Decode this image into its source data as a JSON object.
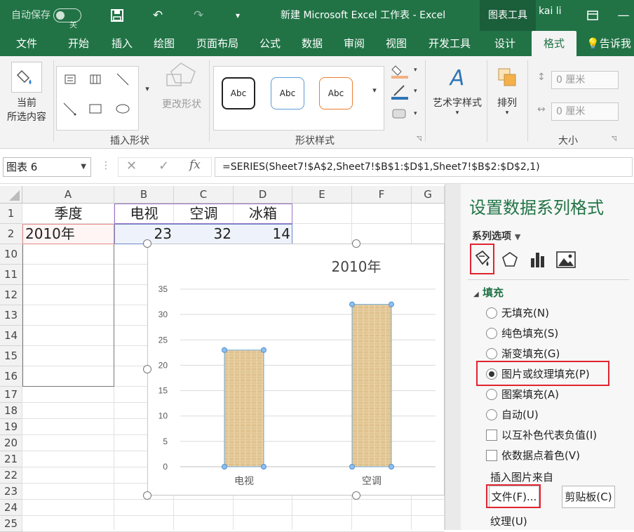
{
  "titlebar": {
    "autosave_label": "自动保存",
    "autosave_state": "关",
    "title": "新建 Microsoft Excel 工作表  -  Excel",
    "context_tab": "图表工具",
    "user": "kai li"
  },
  "tabs": [
    "文件",
    "开始",
    "插入",
    "绘图",
    "页面布局",
    "公式",
    "数据",
    "审阅",
    "视图",
    "开发工具",
    "设计",
    "格式"
  ],
  "active_tab": "格式",
  "tell_me": "告诉我",
  "ribbon": {
    "current_selection_line1": "当前",
    "current_selection_line2": "所选内容",
    "change_shape": "更改形状",
    "group_insert_shapes": "插入形状",
    "style_sample": "Abc",
    "group_shape_styles": "形状样式",
    "wordart": "艺术字样式",
    "arrange": "排列",
    "height_value": "0 厘米",
    "width_value": "0 厘米",
    "group_size": "大小"
  },
  "formula_bar": {
    "name_box": "图表 6",
    "fx": "fx",
    "formula": "=SERIES(Sheet7!$A$2,Sheet7!$B$1:$D$1,Sheet7!$B$2:$D$2,1)"
  },
  "sheet": {
    "columns": [
      "A",
      "B",
      "C",
      "D",
      "E",
      "F",
      "G"
    ],
    "rows": [
      "1",
      "2",
      "10",
      "11",
      "12",
      "13",
      "14",
      "15",
      "16",
      "17",
      "18",
      "19",
      "20",
      "21",
      "22",
      "23",
      "24",
      "25"
    ],
    "a1": "季度",
    "b1": "电视",
    "c1": "空调",
    "d1": "冰箱",
    "a2": "2010年",
    "b2": "23",
    "c2": "32",
    "d2": "14"
  },
  "chart_data": {
    "type": "bar",
    "title": "2010年",
    "categories": [
      "电视",
      "空调"
    ],
    "values": [
      23,
      32
    ],
    "ylim": [
      0,
      35
    ],
    "yticks": [
      "0",
      "5",
      "10",
      "15",
      "20",
      "25",
      "30",
      "35"
    ],
    "grid": true,
    "fill": "texture"
  },
  "panel": {
    "title": "设置数据系列格式",
    "series_options": "系列选项",
    "fill_section": "填充",
    "fill_options": [
      "无填充(N)",
      "纯色填充(S)",
      "渐变填充(G)",
      "图片或纹理填充(P)",
      "图案填充(A)",
      "自动(U)"
    ],
    "selected_fill": "图片或纹理填充(P)",
    "invert_negative": "以互补色代表负值(I)",
    "vary_colors": "依数据点着色(V)",
    "insert_from": "插入图片来自",
    "file_button": "文件(F)...",
    "clipboard_button": "剪贴板(C)",
    "texture_label": "纹理(U)"
  },
  "colors": {
    "excel_green": "#217346",
    "highlight_red": "#e0242f",
    "texture_fill": "#e5ca9a"
  }
}
